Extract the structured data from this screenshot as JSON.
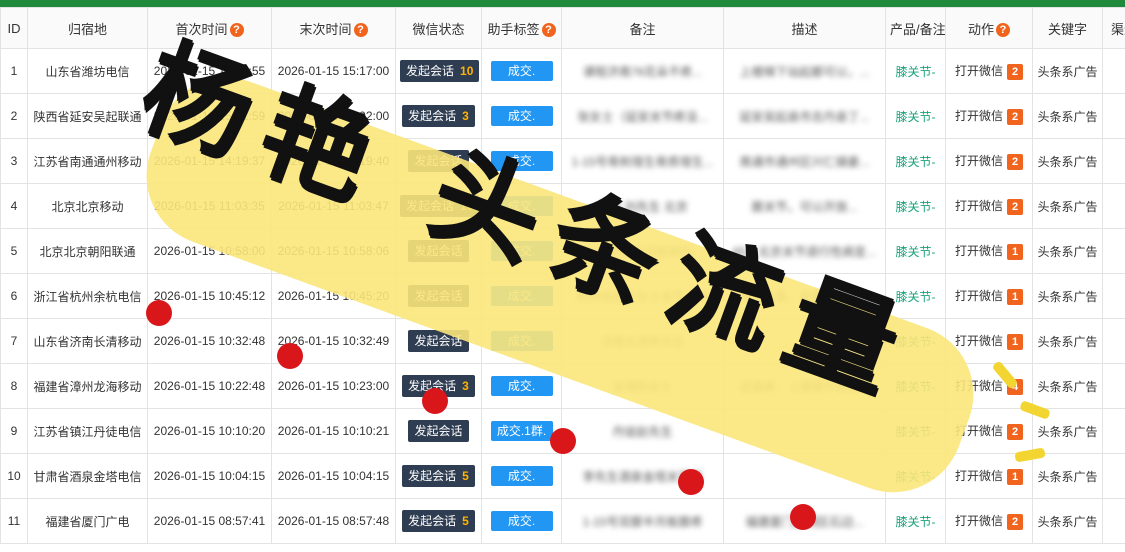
{
  "headers": {
    "id": "ID",
    "location": "归宿地",
    "first_time": "首次时间",
    "last_time": "末次时间",
    "wechat_status": "微信状态",
    "assistant_tag": "助手标签",
    "note": "备注",
    "desc": "描述",
    "product_note": "产品/备注",
    "action": "动作",
    "keyword": "关键字",
    "channel": "渠道",
    "help_icon": "?"
  },
  "rows": [
    {
      "id": "1",
      "location": "山东省潍坊电信",
      "first": "2026-01-15 15:16:55",
      "last": "2026-01-15 15:17:00",
      "chat": "发起会话",
      "chat_count": "10",
      "tag": "成交.",
      "note": "课程济南76花朵不疼...",
      "desc": "上楼梯下站起都可以，...",
      "product": "膝关节-",
      "action": "打开微信",
      "action_count": "2",
      "keyword": "头条系广告"
    },
    {
      "id": "2",
      "location": "陕西省延安吴起联通",
      "first": "2026-01-15 15:01:59",
      "last": "2026-01-15 15:02:00",
      "chat": "发起会话",
      "chat_count": "3",
      "tag": "成交.",
      "note": "张女士（延安关节疼没...",
      "desc": "延安吴起县市志丹县丁...",
      "product": "膝关节-",
      "action": "打开微信",
      "action_count": "2",
      "keyword": "头条系广告"
    },
    {
      "id": "3",
      "location": "江苏省南通通州移动",
      "first": "2026-01-15 14:19:37",
      "last": "2026-01-15 14:19:40",
      "chat": "发起会话",
      "chat_count": "",
      "tag": "成交.",
      "note": "1-15号骨刺增生骨质增生...",
      "desc": "南通市通州区兴仁镇姜...",
      "product": "膝关节-",
      "action": "打开微信",
      "action_count": "2",
      "keyword": "头条系广告"
    },
    {
      "id": "4",
      "location": "北京北京移动",
      "first": "2026-01-15 11:03:35",
      "last": "2026-01-15 11:03:47",
      "chat": "发起会话",
      "chat_count": "10",
      "tag": "成交.",
      "note": "北京 刘先生 北京",
      "desc": "膝关节，可以开放...",
      "product": "膝关节-",
      "action": "打开微信",
      "action_count": "2",
      "keyword": "头条系广告"
    },
    {
      "id": "5",
      "location": "北京北京朝阳联通",
      "first": "2026-01-15 10:58:00",
      "last": "2026-01-15 10:58:06",
      "chat": "发起会话",
      "chat_count": "",
      "tag": "成交.",
      "note": "王先生65半月板损伤...",
      "desc": "65，北京关节退行性病变...",
      "product": "膝关节-",
      "action": "打开微信",
      "action_count": "1",
      "keyword": "头条系广告"
    },
    {
      "id": "6",
      "location": "浙江省杭州余杭电信",
      "first": "2026-01-15 10:45:12",
      "last": "2026-01-15 10:45:20",
      "chat": "发起会话",
      "chat_count": "",
      "tag": "成交.",
      "note": "杭州余杭王女士关节炎肿",
      "desc": "蹲下起来，走路膝疼无...",
      "product": "膝关节-",
      "action": "打开微信",
      "action_count": "1",
      "keyword": "头条系广告"
    },
    {
      "id": "7",
      "location": "山东省济南长清移动",
      "first": "2026-01-15 10:32:48",
      "last": "2026-01-15 10:32:49",
      "chat": "发起会话",
      "chat_count": "",
      "tag": "成交.",
      "note": "济南长清李先生",
      "desc": "",
      "product": "膝关节-",
      "action": "打开微信",
      "action_count": "1",
      "keyword": "头条系广告"
    },
    {
      "id": "8",
      "location": "福建省漳州龙海移动",
      "first": "2026-01-15 10:22:48",
      "last": "2026-01-15 10:23:00",
      "chat": "发起会话",
      "chat_count": "3",
      "tag": "成交.",
      "note": "龙海陈女士",
      "desc": "走路疼，上楼梯不定期...",
      "product": "膝关节-",
      "action": "打开微信",
      "action_count": "4",
      "keyword": "头条系广告"
    },
    {
      "id": "9",
      "location": "江苏省镇江丹徒电信",
      "first": "2026-01-15 10:10:20",
      "last": "2026-01-15 10:10:21",
      "chat": "发起会话",
      "chat_count": "",
      "tag": "成交.1群.",
      "note": "丹徒赵先生",
      "desc": "",
      "product": "膝关节-",
      "action": "打开微信",
      "action_count": "2",
      "keyword": "头条系广告"
    },
    {
      "id": "10",
      "location": "甘肃省酒泉金塔电信",
      "first": "2026-01-15 10:04:15",
      "last": "2026-01-15 10:04:15",
      "chat": "发起会话",
      "chat_count": "5",
      "tag": "成交.",
      "note": "李先生酒泉金塔关节疼",
      "desc": "",
      "product": "膝关节-",
      "action": "打开微信",
      "action_count": "1",
      "keyword": "头条系广告"
    },
    {
      "id": "11",
      "location": "福建省厦门广电",
      "first": "2026-01-15 08:57:41",
      "last": "2026-01-15 08:57:48",
      "chat": "发起会话",
      "chat_count": "5",
      "tag": "成交.",
      "note": "1-15号双膝半月板膝疼",
      "desc": "福建厦门思明区石边...",
      "product": "膝关节-",
      "action": "打开微信",
      "action_count": "2",
      "keyword": "头条系广告"
    }
  ],
  "overlay": {
    "text": "杨艳 头条流量",
    "banner_color": "#fbe67a",
    "dot_color": "#d9161a"
  },
  "colors": {
    "topbar": "#1f8a3c",
    "chat_button": "#2f3d52",
    "chat_count": "#ffb300",
    "tag_button": "#2196f3",
    "product_text": "#1aa37a",
    "badge": "#f0641e"
  }
}
